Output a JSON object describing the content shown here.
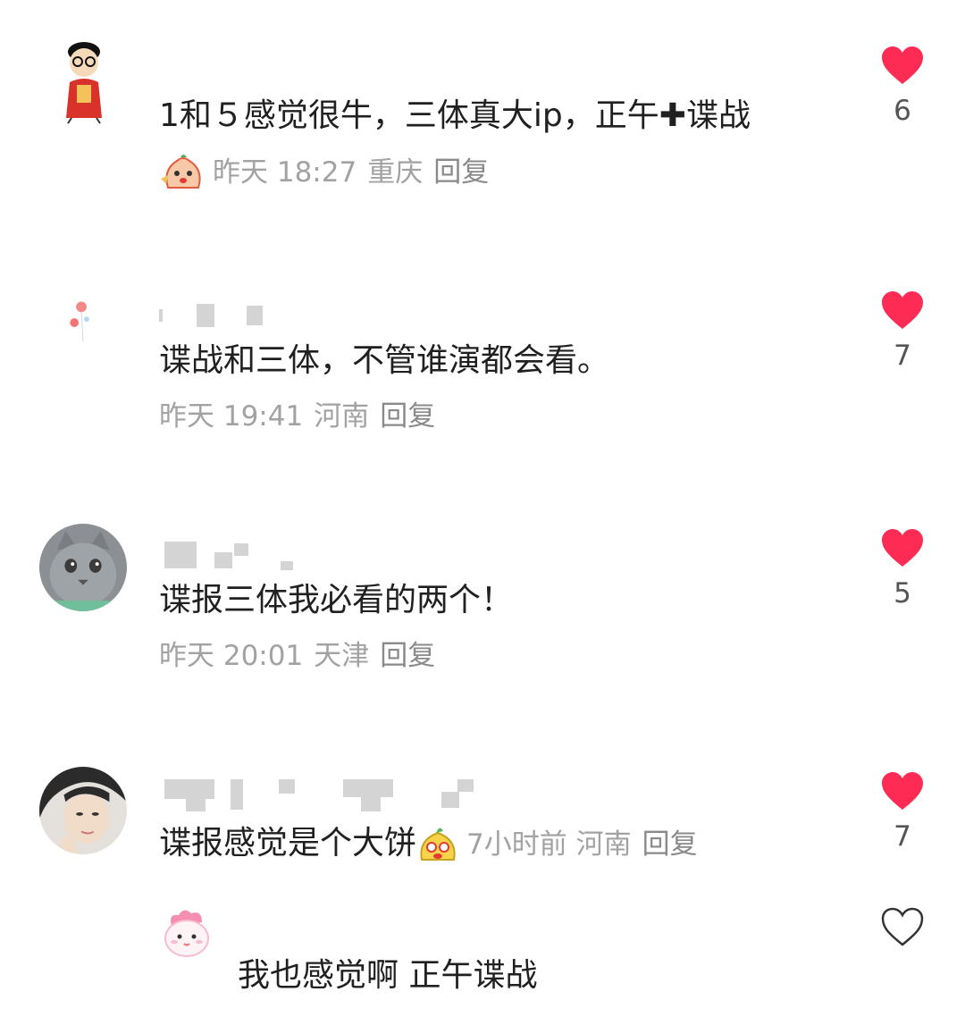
{
  "comments": [
    {
      "text_parts": [
        "1和５感觉很牛，三体真大ip，正午",
        "✚",
        "谍战"
      ],
      "time": "昨天 18:27",
      "region": "重庆",
      "reply": "回复",
      "likes": "6",
      "liked": true
    },
    {
      "text": "谍战和三体，不管谁演都会看。",
      "time": "昨天 19:41",
      "region": "河南",
      "reply": "回复",
      "likes": "7",
      "liked": true
    },
    {
      "text": "谍报三体我必看的两个！",
      "time": "昨天 20:01",
      "region": "天津",
      "reply": "回复",
      "likes": "5",
      "liked": true
    },
    {
      "text": "谍报感觉是个大饼",
      "time": "7小时前",
      "region": "河南",
      "reply": "回复",
      "likes": "7",
      "liked": true
    },
    {
      "text": "我也感觉啊 正午谍战",
      "liked": false
    }
  ],
  "colors": {
    "like_red": "#fe2c55",
    "meta_gray": "#a2a2a2",
    "text": "#202020"
  },
  "icons": {
    "like": "heart-icon",
    "sticker": "sticker-emoji-icon"
  }
}
